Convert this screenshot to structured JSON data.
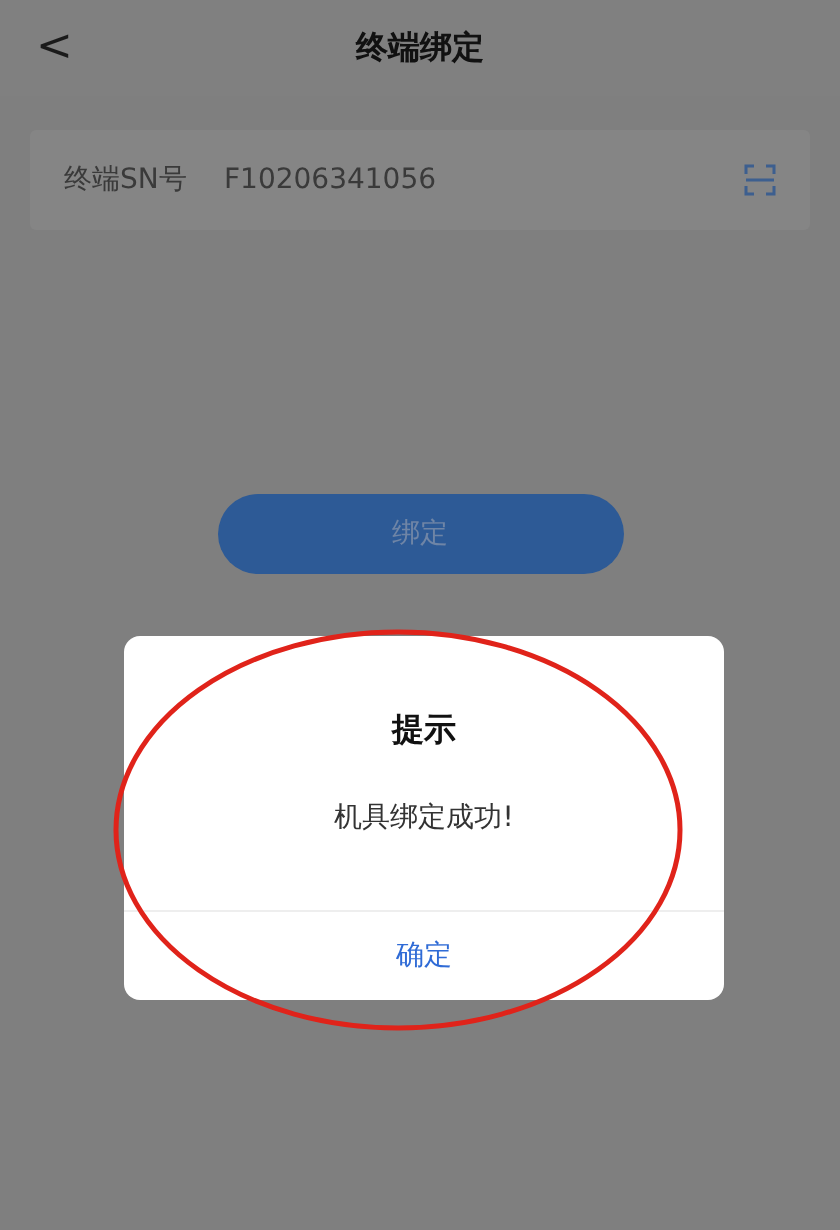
{
  "header": {
    "back": "<",
    "title": "终端绑定"
  },
  "field": {
    "label": "终端SN号",
    "value": "F10206341056"
  },
  "bind_button": "绑定",
  "dialog": {
    "title": "提示",
    "message": "机具绑定成功!",
    "confirm": "确定"
  }
}
